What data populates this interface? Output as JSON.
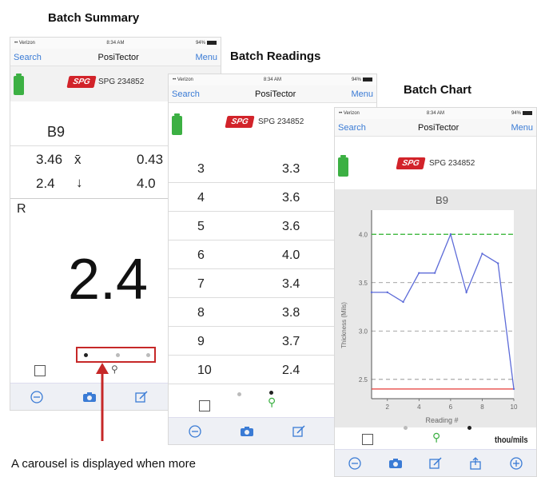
{
  "captions": {
    "summary": "Batch Summary",
    "readings": "Batch Readings",
    "chart": "Batch Chart",
    "bottom_note": "A carousel is displayed when more"
  },
  "statusbar": {
    "carrier": "•• Verizon",
    "time": "8:34 AM",
    "battery": "94%"
  },
  "navbar": {
    "left": "Search",
    "title": "PosiTector",
    "right": "Menu"
  },
  "device": {
    "logo": "SPG",
    "serial": "SPG 234852"
  },
  "summary": {
    "batch": "B9",
    "mean_value": "3.46",
    "mean_symbol": "x̄",
    "mean_right": "0.43",
    "min_value": "2.4",
    "min_symbol": "↓",
    "min_right": "4.0",
    "mode_label": "R",
    "reading": "2.4"
  },
  "readings": {
    "rows": [
      {
        "index": "3",
        "value": "3.3"
      },
      {
        "index": "4",
        "value": "3.6"
      },
      {
        "index": "5",
        "value": "3.6"
      },
      {
        "index": "6",
        "value": "4.0"
      },
      {
        "index": "7",
        "value": "3.4"
      },
      {
        "index": "8",
        "value": "3.8"
      },
      {
        "index": "9",
        "value": "3.7"
      },
      {
        "index": "10",
        "value": "2.4"
      }
    ]
  },
  "chart_toolbar": {
    "units": "thou/mils"
  },
  "colors": {
    "accent": "#3a7bd5",
    "logo_red": "#d2232a",
    "battery_green": "#3cb043",
    "line_blue": "#5d6bd8",
    "max_line_green": "#2fb52f",
    "min_line_red": "#e53935",
    "carousel_box_red": "#c62828"
  },
  "chart_data": {
    "type": "line",
    "title": "B9",
    "xlabel": "Reading #",
    "ylabel": "Thickness (Mils)",
    "x": [
      1,
      2,
      3,
      4,
      5,
      6,
      7,
      8,
      9,
      10
    ],
    "series": [
      {
        "values": [
          3.4,
          3.4,
          3.3,
          3.6,
          3.6,
          4.0,
          3.4,
          3.8,
          3.7,
          2.4
        ]
      }
    ],
    "reference_lines": [
      {
        "value": 4.0,
        "color": "green"
      },
      {
        "value": 2.4,
        "color": "red"
      }
    ],
    "xticks": [
      "2",
      "4",
      "6",
      "8",
      "10"
    ],
    "yticks": [
      "2.5",
      "3.0",
      "3.5",
      "4.0"
    ],
    "xlim": [
      1,
      10
    ],
    "ylim": [
      2.3,
      4.25
    ],
    "grid": "horizontal dashed"
  }
}
